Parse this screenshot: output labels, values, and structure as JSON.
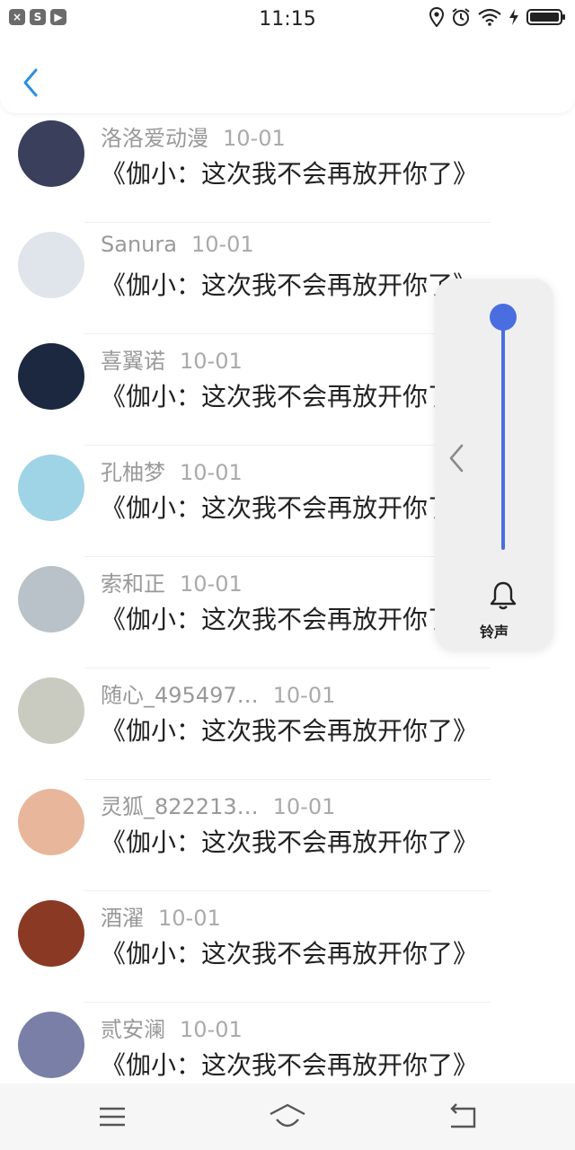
{
  "status_bar": {
    "time": "11:15",
    "app_icons": [
      "x-app-icon",
      "s-app-icon",
      "play-app-icon"
    ]
  },
  "header": {
    "back_icon": "chevron-left-icon"
  },
  "comments": [
    {
      "name": "洛洛爱动漫",
      "date": "10-01",
      "text": "《伽小：这次我不会再放开你了》",
      "avatar_color": "#3a3f5c"
    },
    {
      "name": "Sanura",
      "date": "10-01",
      "text": "《伽小：这次我不会再放开你了》",
      "avatar_color": "#dfe5ea"
    },
    {
      "name": "喜翼诺",
      "date": "10-01",
      "text": "《伽小：这次我不会再放开你了》",
      "avatar_color": "#1c2740"
    },
    {
      "name": "孔柚梦",
      "date": "10-01",
      "text": "《伽小：这次我不会再放开你了》",
      "avatar_color": "#9fd3e6"
    },
    {
      "name": "索和正",
      "date": "10-01",
      "text": "《伽小：这次我不会再放开你了》",
      "avatar_color": "#b8c2c8"
    },
    {
      "name": "随心_495497…",
      "date": "10-01",
      "text": "《伽小：这次我不会再放开你了》",
      "avatar_color": "#c9cbc0"
    },
    {
      "name": "灵狐_822213…",
      "date": "10-01",
      "text": "《伽小：这次我不会再放开你了》",
      "avatar_color": "#e8b69a"
    },
    {
      "name": "酒濯",
      "date": "10-01",
      "text": "《伽小：这次我不会再放开你了》",
      "avatar_color": "#8a3a24"
    },
    {
      "name": "贰安澜",
      "date": "10-01",
      "text": "《伽小：这次我不会再放开你了》",
      "avatar_color": "#7a7fa8"
    }
  ],
  "volume_panel": {
    "label": "铃声",
    "level": 1.0,
    "accent": "#4a6ee0"
  },
  "bottom_nav": {
    "icons": [
      "menu-icon",
      "home-icon",
      "back-icon"
    ]
  }
}
